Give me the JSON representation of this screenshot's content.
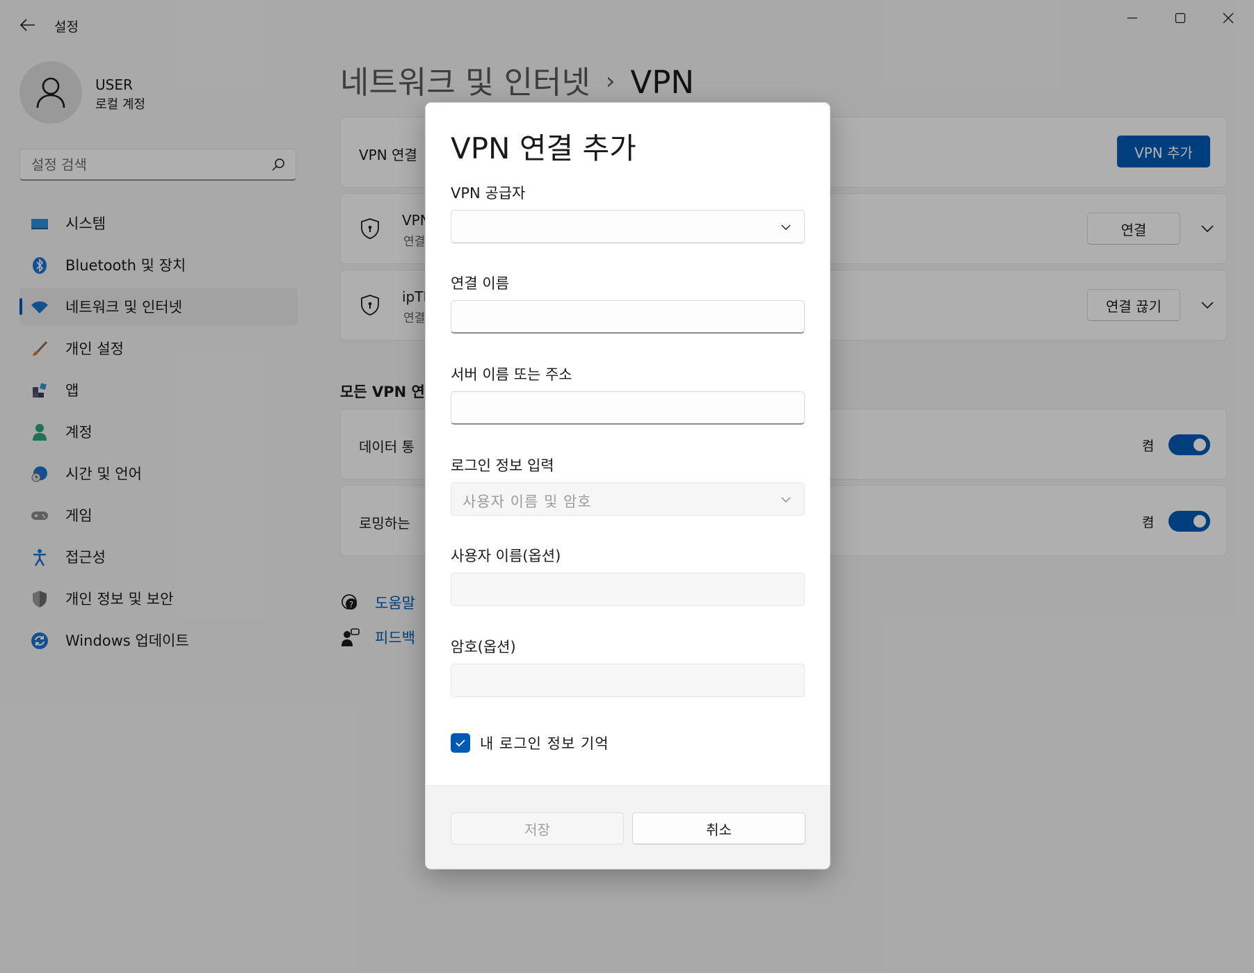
{
  "window": {
    "title": "설정",
    "controls": [
      "minimize-icon",
      "maximize-icon",
      "close-icon"
    ]
  },
  "profile": {
    "name": "USER",
    "account_type": "로컬 계정"
  },
  "search": {
    "placeholder": "설정 검색"
  },
  "sidebar": {
    "items": [
      {
        "label": "시스템",
        "icon": "system-icon"
      },
      {
        "label": "Bluetooth 및 장치",
        "icon": "bluetooth-icon"
      },
      {
        "label": "네트워크 및 인터넷",
        "icon": "network-icon",
        "selected": true
      },
      {
        "label": "개인 설정",
        "icon": "brush-icon"
      },
      {
        "label": "앱",
        "icon": "apps-icon"
      },
      {
        "label": "계정",
        "icon": "account-icon"
      },
      {
        "label": "시간 및 언어",
        "icon": "time-language-icon"
      },
      {
        "label": "게임",
        "icon": "gamepad-icon"
      },
      {
        "label": "접근성",
        "icon": "accessibility-icon"
      },
      {
        "label": "개인 정보 및 보안",
        "icon": "shield-icon"
      },
      {
        "label": "Windows 업데이트",
        "icon": "update-icon"
      }
    ]
  },
  "header": {
    "parent": "네트워크 및 인터넷",
    "current": "VPN"
  },
  "main": {
    "vpn_connections_label": "VPN 연결",
    "add_vpn_button": "VPN 추가",
    "connections": [
      {
        "name": "VPN",
        "status": "연결",
        "button": "연결"
      },
      {
        "name": "ipTI",
        "status": "연결",
        "button": "연결 끊기"
      }
    ],
    "section_title": "모든 VPN 연",
    "settings": [
      {
        "label": "데이터 통",
        "state": "켬",
        "on": true
      },
      {
        "label": "로밍하는 ",
        "state": "켬",
        "on": true
      }
    ],
    "links": [
      {
        "label": "도움말",
        "icon": "help-icon"
      },
      {
        "label": "피드백",
        "icon": "feedback-icon"
      }
    ]
  },
  "dialog": {
    "title": "VPN 연결 추가",
    "provider_label": "VPN 공급자",
    "provider_value": "",
    "connection_name_label": "연결 이름",
    "connection_name_value": "",
    "server_label": "서버 이름 또는 주소",
    "server_value": "",
    "signin_label": "로그인 정보 입력",
    "signin_value": "사용자 이름 및 암호",
    "username_label": "사용자 이름(옵션)",
    "username_value": "",
    "password_label": "암호(옵션)",
    "password_value": "",
    "remember_label": "내 로그인 정보 기억",
    "remember_checked": true,
    "save_button": "저장",
    "cancel_button": "취소"
  },
  "colors": {
    "accent": "#0059b3",
    "window_bg": "#f3f3f3",
    "card_bg": "#fbfbfb"
  }
}
